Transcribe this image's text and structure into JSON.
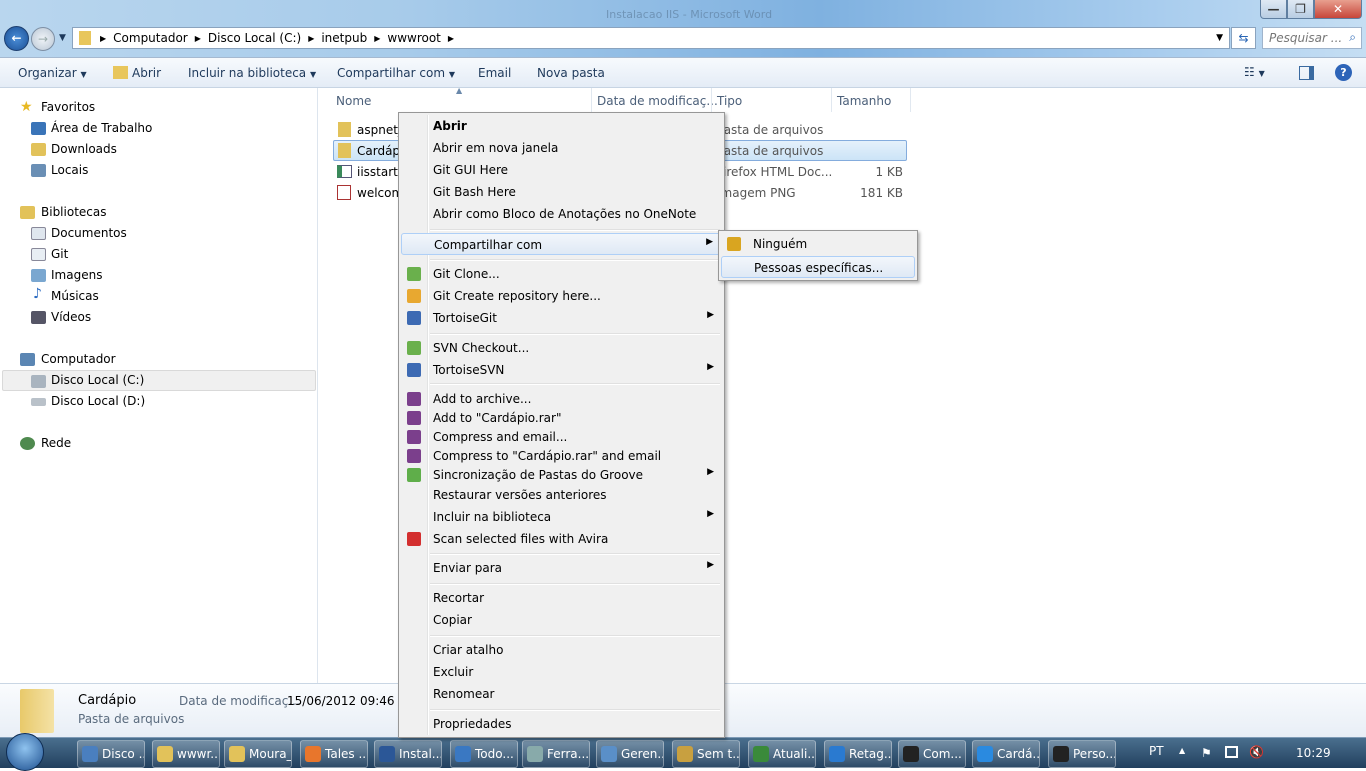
{
  "window": {
    "title": "Instalacao IIS - Microsoft Word",
    "controls": {
      "minimize": "—",
      "restore": "❐",
      "close": "✕"
    }
  },
  "address": {
    "crumbs": [
      "Computador",
      "Disco Local (C:)",
      "inetpub",
      "wwwroot"
    ],
    "search_placeholder": "Pesquisar ..."
  },
  "toolbar": {
    "organize": "Organizar",
    "open": "Abrir",
    "include_library": "Incluir na biblioteca",
    "share_with": "Compartilhar com",
    "email": "Email",
    "new_folder": "Nova pasta"
  },
  "nav": {
    "favorites": "Favoritos",
    "desktop": "Área de Trabalho",
    "downloads": "Downloads",
    "places": "Locais",
    "libraries": "Bibliotecas",
    "documents": "Documentos",
    "git": "Git",
    "images": "Imagens",
    "music": "Músicas",
    "videos": "Vídeos",
    "computer": "Computador",
    "disk_c": "Disco Local (C:)",
    "disk_d": "Disco Local (D:)",
    "network": "Rede"
  },
  "columns": {
    "name": "Nome",
    "date": "Data de modificaç...",
    "type": "Tipo",
    "size": "Tamanho"
  },
  "files": [
    {
      "name": "aspnet_",
      "type": "Pasta de arquivos",
      "size": ""
    },
    {
      "name": "Cardápio",
      "type": "Pasta de arquivos",
      "size": ""
    },
    {
      "name": "iisstart",
      "type": "Firefox HTML Doc...",
      "size": "1 KB"
    },
    {
      "name": "welcom",
      "type": "Imagem PNG",
      "size": "181 KB"
    }
  ],
  "details": {
    "name": "Cardápio",
    "kind": "Pasta de arquivos",
    "date_label": "Data de modificaç...",
    "date_value": "15/06/2012 09:46"
  },
  "context_menu": [
    {
      "label": "Abrir",
      "bold": true
    },
    {
      "label": "Abrir em nova janela"
    },
    {
      "label": "Git GUI Here"
    },
    {
      "label": "Git Bash Here"
    },
    {
      "label": "Abrir como Bloco de Anotações no OneNote"
    },
    {
      "label": "Compartilhar com",
      "submenu": true,
      "highlighted": true
    },
    {
      "label": "Git Clone...",
      "icon": "git-clone-icon"
    },
    {
      "label": "Git Create repository here...",
      "icon": "git-create-repo-icon"
    },
    {
      "label": "TortoiseGit",
      "submenu": true,
      "icon": "tortoisegit-icon"
    },
    {
      "label": "SVN Checkout...",
      "icon": "svn-checkout-icon"
    },
    {
      "label": "TortoiseSVN",
      "submenu": true,
      "icon": "tortoisesvn-icon"
    },
    {
      "label": "Add to archive...",
      "icon": "winrar-icon"
    },
    {
      "label": "Add to \"Cardápio.rar\"",
      "icon": "winrar-icon"
    },
    {
      "label": "Compress and email...",
      "icon": "winrar-icon"
    },
    {
      "label": "Compress to \"Cardápio.rar\" and email",
      "icon": "winrar-icon"
    },
    {
      "label": "Sincronização de Pastas do Groove",
      "submenu": true,
      "icon": "groove-icon"
    },
    {
      "label": "Restaurar versões anteriores"
    },
    {
      "label": "Incluir na biblioteca",
      "submenu": true
    },
    {
      "label": "Scan selected files with Avira",
      "icon": "avira-icon"
    },
    {
      "label": "Enviar para",
      "submenu": true
    },
    {
      "label": "Recortar"
    },
    {
      "label": "Copiar"
    },
    {
      "label": "Criar atalho"
    },
    {
      "label": "Excluir"
    },
    {
      "label": "Renomear"
    },
    {
      "label": "Propriedades"
    }
  ],
  "submenu": [
    {
      "label": "Ninguém",
      "icon": "lock-icon"
    },
    {
      "label": "Pessoas específicas...",
      "highlighted": true
    }
  ],
  "taskbar": {
    "items": [
      "Disco ...",
      "wwwr...",
      "Moura_",
      "Tales ...",
      "Instal...",
      "Todo...",
      "Ferra...",
      "Geren...",
      "Sem t...",
      "Atuali...",
      "Retag...",
      "Com...",
      "Cardá...",
      "Perso..."
    ],
    "language": "PT",
    "clock": "10:29"
  },
  "colors": {
    "selection": "#cce8ff",
    "menu_bg": "#f0f0f0",
    "taskbar": "#2c4a68",
    "close_button": "#c7463a"
  }
}
